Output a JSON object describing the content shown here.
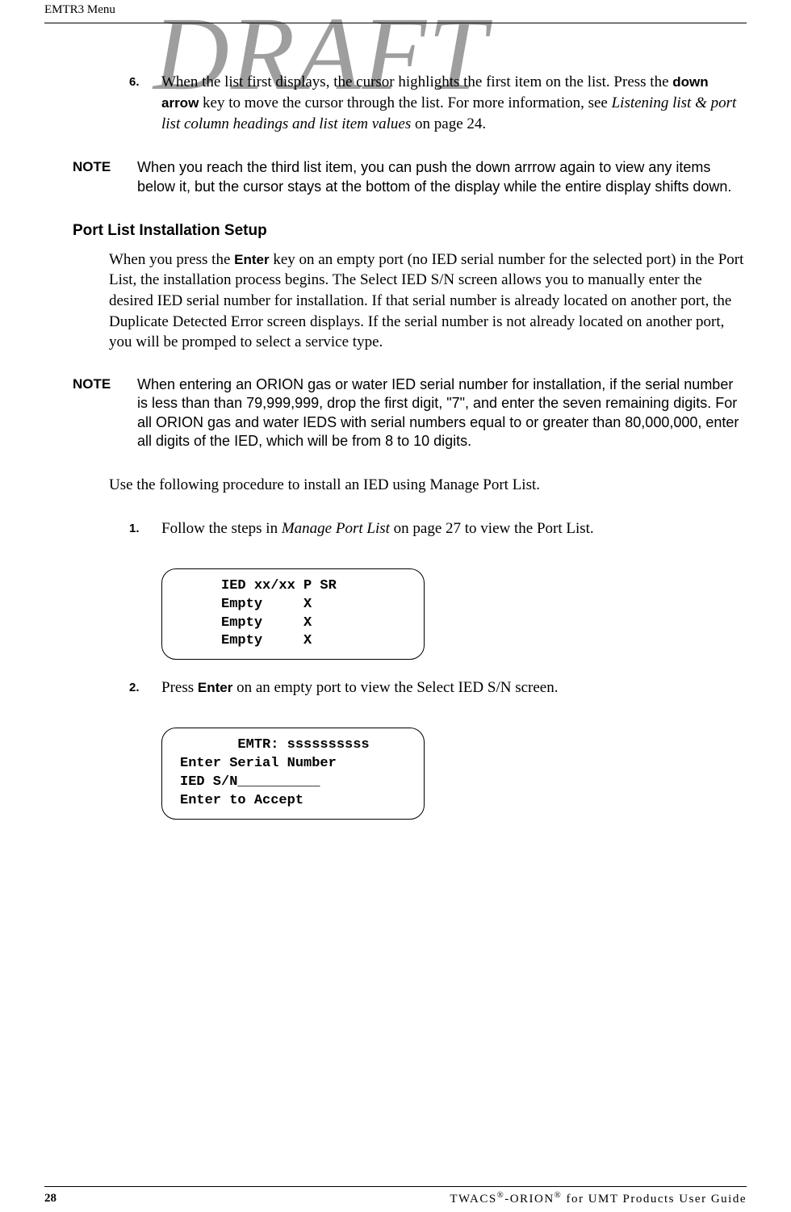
{
  "watermark": "DRAFT",
  "running_head": "EMTR3 Menu",
  "steps": {
    "s6": {
      "num": "6.",
      "pre": "When the list first displays, the cursor highlights the first item on the list. Press the ",
      "key": "down arrow",
      "mid": " key to move the cursor through the list. For more information, see ",
      "ref": "Listening list & port list column headings and list item values",
      "post": " on page 24."
    },
    "s1": {
      "num": "1.",
      "pre": "Follow the steps in ",
      "ref": "Manage Port List",
      "post": " on page 27 to view the Port List."
    },
    "s2": {
      "num": "2.",
      "pre": "Press ",
      "key": "Enter",
      "post": " on an empty port to view the Select IED S/N screen."
    }
  },
  "notes": {
    "label": "NOTE",
    "n1": "When you reach the third list item, you can push the down arrrow again to view any items below it, but the cursor stays at the bottom of the display while the entire display shifts down.",
    "n2": "When entering an ORION gas or water IED serial number for installation, if the serial number is less than than 79,999,999, drop the first digit, \"7\", and enter the seven remaining digits. For all ORION gas and water IEDS with serial numbers equal to or greater than 80,000,000, enter all digits of the IED, which will be from 8 to 10 digits."
  },
  "heading": "Port List Installation Setup",
  "para1": {
    "pre": "When you press the ",
    "key": "Enter",
    "post": " key on an empty port (no IED serial number for the selected port) in the Port List, the installation process begins. The Select IED S/N screen allows you to manually enter the desired IED serial number for installation. If that serial number is already located on another port, the Duplicate Detected Error screen displays. If the serial number is not already located on another port, you will be promped to select a service type."
  },
  "para2": "Use the following procedure to install an IED using Manage Port List.",
  "lcd1": {
    "l1": "     IED xx/xx P SR",
    "l2": "     Empty     X",
    "l3": "     Empty     X",
    "l4": "     Empty     X"
  },
  "lcd2": {
    "l1": "       EMTR: ssssssssss",
    "l2": "Enter Serial Number",
    "l3": "IED S/N__________",
    "l4": "Enter to Accept"
  },
  "footer": {
    "page": "28",
    "right_pre": "TWACS",
    "reg": "®",
    "right_mid": "-ORION",
    "right_post": " for UMT Products User Guide"
  }
}
